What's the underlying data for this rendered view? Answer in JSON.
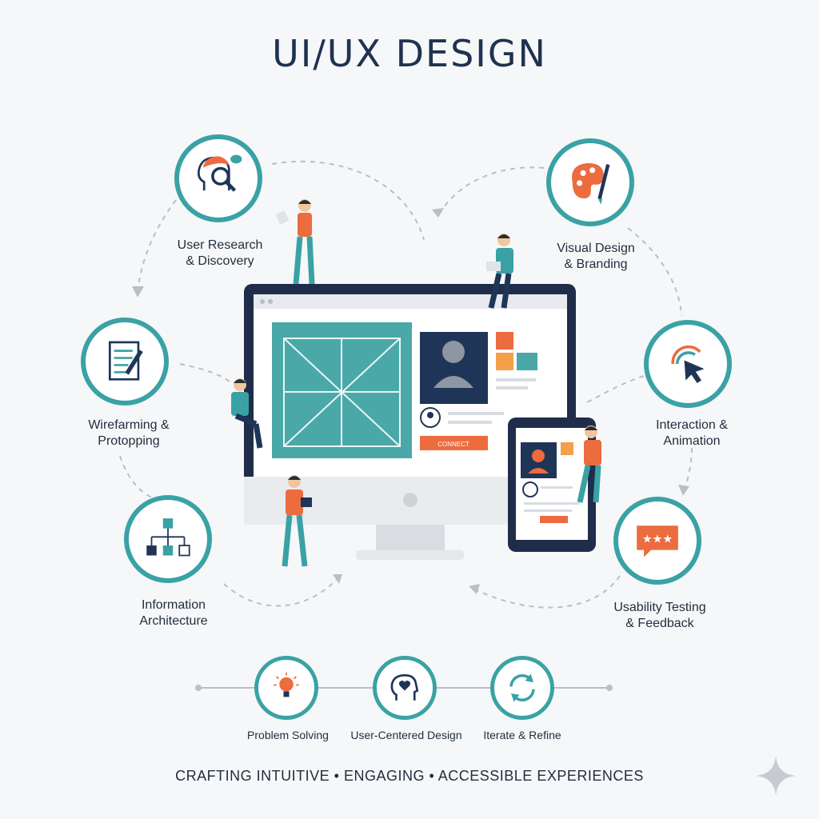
{
  "title": "UI/UX DESIGN",
  "stages": [
    {
      "line1": "User Research",
      "line2": "& Discovery",
      "icon": "head-magnifier-icon"
    },
    {
      "line1": "Visual Design",
      "line2": "& Branding",
      "icon": "palette-brush-icon"
    },
    {
      "line1": "Wirefarming &",
      "line2": "Protopping",
      "icon": "notepad-pencil-icon"
    },
    {
      "line1": "Interaction &",
      "line2": "Animation",
      "icon": "cursor-click-icon"
    },
    {
      "line1": "Information",
      "line2": "Architecture",
      "icon": "sitemap-icon"
    },
    {
      "line1": "Usability Testing",
      "line2": "& Feedback",
      "icon": "rating-bubble-icon"
    }
  ],
  "principles": [
    {
      "label": "Problem Solving",
      "icon": "lightbulb-icon"
    },
    {
      "label": "User-Centered Design",
      "icon": "head-heart-icon"
    },
    {
      "label": "Iterate & Refine",
      "icon": "refresh-icon"
    }
  ],
  "center_button": "CONNECT",
  "tagline": "CRAFTING INTUITIVE • ENGAGING • ACCESSIBLE EXPERIENCES",
  "colors": {
    "teal": "#3aa2a5",
    "orange": "#ec6b3f",
    "navy": "#1f2d4a"
  }
}
